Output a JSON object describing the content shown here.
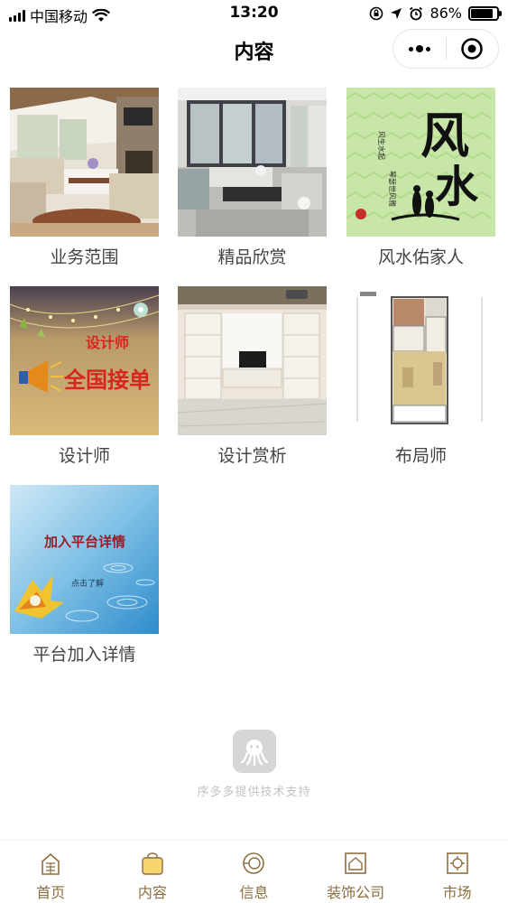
{
  "status_bar": {
    "carrier": "中国移动",
    "time": "13:20",
    "battery_text": "86%",
    "battery_level": 0.86
  },
  "nav": {
    "title": "内容"
  },
  "grid": {
    "items": [
      {
        "label": "业务范围"
      },
      {
        "label": "精品欣赏"
      },
      {
        "label": "风水佑家人",
        "art": {
          "big_char_1": "风",
          "big_char_2": "水",
          "side_line_1": "风生水起",
          "side_line_2": "琴瑟世风雅"
        }
      },
      {
        "label": "设计师",
        "art": {
          "line_1": "设计师",
          "line_2": "全国接单"
        }
      },
      {
        "label": "设计赏析"
      },
      {
        "label": "布局师"
      },
      {
        "label": "平台加入详情",
        "art": {
          "line_1": "加入平台详情",
          "line_2": "点击了解"
        }
      }
    ]
  },
  "brand": {
    "text": "序多多提供技术支持"
  },
  "tab_bar": {
    "items": [
      {
        "label": "首页"
      },
      {
        "label": "内容"
      },
      {
        "label": "信息"
      },
      {
        "label": "装饰公司"
      },
      {
        "label": "市场"
      }
    ],
    "active_index": 1
  },
  "colors": {
    "tab_text": "#8d6e3f",
    "tab_active_icon": "#f7d66d",
    "brand_text": "#c2c2c2"
  }
}
